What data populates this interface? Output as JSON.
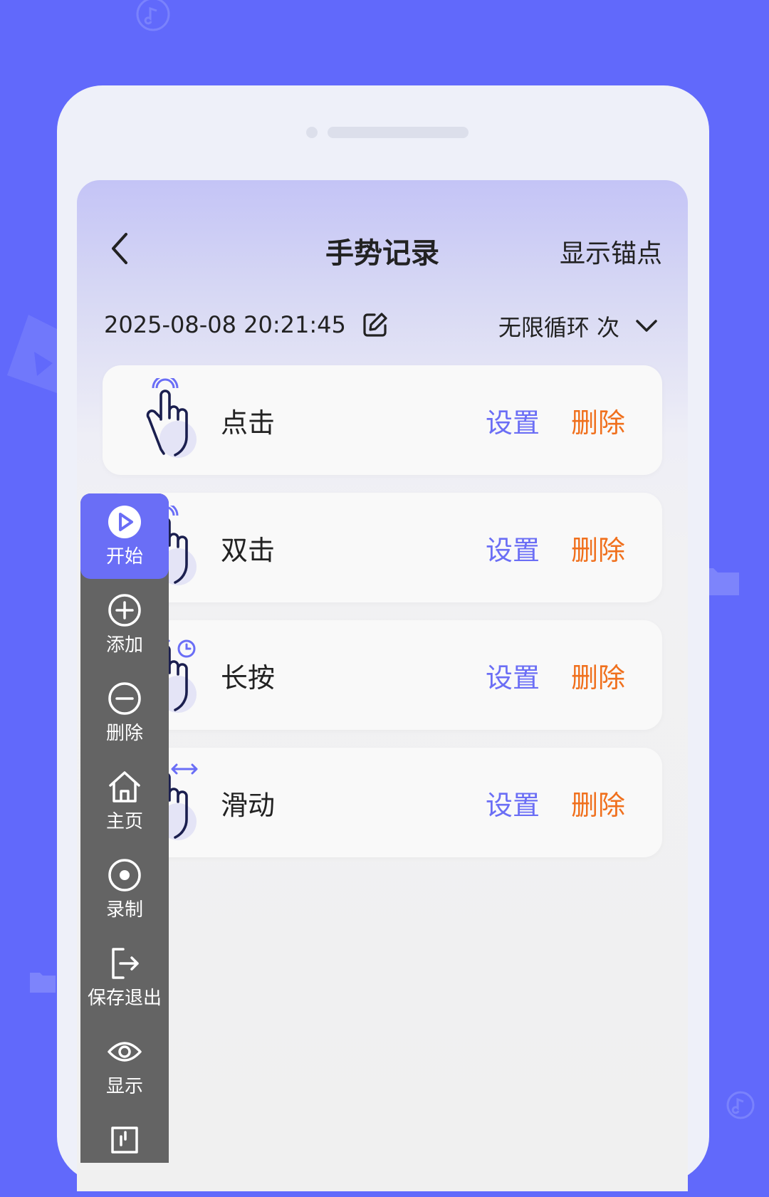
{
  "app": {
    "title": "手势记录",
    "back_icon": "chevron-left-icon",
    "anchor_label": "显示锚点"
  },
  "record": {
    "datetime": "2025-08-08 20:21:45",
    "edit_icon": "edit-icon",
    "loop_label": "无限循环 次",
    "loop_icon": "chevron-down-icon"
  },
  "gestures": [
    {
      "name": "点击",
      "icon": "tap-hand-icon",
      "set_label": "设置",
      "delete_label": "删除"
    },
    {
      "name": "双击",
      "icon": "double-tap-hand-icon",
      "set_label": "设置",
      "delete_label": "删除"
    },
    {
      "name": "长按",
      "icon": "long-press-hand-icon",
      "set_label": "设置",
      "delete_label": "删除"
    },
    {
      "name": "滑动",
      "icon": "swipe-hand-icon",
      "set_label": "设置",
      "delete_label": "删除"
    }
  ],
  "sidebar": {
    "items": [
      {
        "label": "开始",
        "icon": "play-icon",
        "active": true
      },
      {
        "label": "添加",
        "icon": "plus-circle-icon"
      },
      {
        "label": "删除",
        "icon": "minus-circle-icon"
      },
      {
        "label": "主页",
        "icon": "home-icon"
      },
      {
        "label": "录制",
        "icon": "record-icon"
      },
      {
        "label": "保存退出",
        "icon": "exit-icon"
      },
      {
        "label": "显示",
        "icon": "eye-icon"
      },
      {
        "label": "",
        "icon": "more-icon"
      }
    ]
  },
  "colors": {
    "background": "#6169fb",
    "accent": "#6b6ef5",
    "delete": "#f0701d",
    "sidebar": "#646464"
  }
}
